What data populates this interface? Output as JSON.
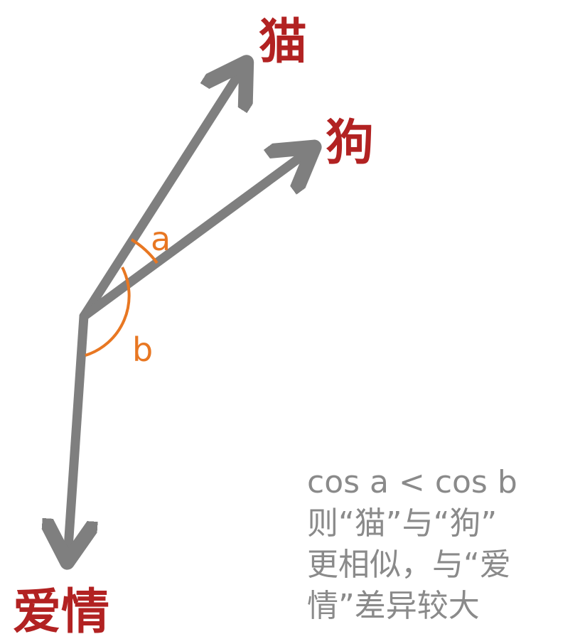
{
  "words": {
    "cat": "猫",
    "dog": "狗",
    "love": "爱情"
  },
  "angles": {
    "a": "a",
    "b": "b"
  },
  "caption": {
    "line1": "cos a  < cos b",
    "line2": "则“猫”与“狗”",
    "line3": "更相似，与“爱",
    "line4": "情”差异较大"
  },
  "colors": {
    "arrow": "#7f7f7f",
    "word": "#b22222",
    "angle": "#e87722",
    "caption": "#8a8a8a"
  }
}
